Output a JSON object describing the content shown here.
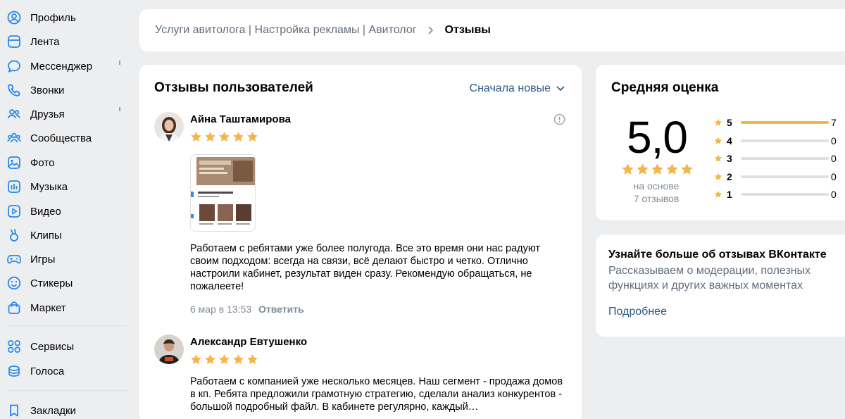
{
  "sidebar": {
    "items": [
      {
        "label": "Профиль",
        "icon": "profile-icon"
      },
      {
        "label": "Лента",
        "icon": "feed-icon"
      },
      {
        "label": "Мессенджер",
        "icon": "messenger-icon"
      },
      {
        "label": "Звонки",
        "icon": "phone-icon"
      },
      {
        "label": "Друзья",
        "icon": "friends-icon"
      },
      {
        "label": "Сообщества",
        "icon": "communities-icon"
      },
      {
        "label": "Фото",
        "icon": "photo-icon"
      },
      {
        "label": "Музыка",
        "icon": "music-icon"
      },
      {
        "label": "Видео",
        "icon": "video-icon"
      },
      {
        "label": "Клипы",
        "icon": "clips-icon"
      },
      {
        "label": "Игры",
        "icon": "games-icon"
      },
      {
        "label": "Стикеры",
        "icon": "stickers-icon"
      },
      {
        "label": "Маркет",
        "icon": "market-icon"
      }
    ],
    "items2": [
      {
        "label": "Сервисы",
        "icon": "services-icon"
      },
      {
        "label": "Голоса",
        "icon": "votes-icon"
      }
    ],
    "items3": [
      {
        "label": "Закладки",
        "icon": "bookmark-icon"
      }
    ]
  },
  "breadcrumb": {
    "parent": "Услуги авитолога | Настройка рекламы | Авитолог",
    "current": "Отзывы"
  },
  "reviews": {
    "title": "Отзывы пользователей",
    "sort_label": "Сначала новые",
    "items": [
      {
        "author": "Айна Таштамирова",
        "rating": 5,
        "text": "Работаем с ребятами уже более полугода. Все это время они нас радуют своим подходом: всегда на связи, всё делают быстро и четко. Отлично настроили кабинет, результат виден сразу. Рекомендую обращаться, не пожалеете!",
        "date": "6 мар в 13:53",
        "reply": "Ответить"
      },
      {
        "author": "Александр Евтушенко",
        "rating": 5,
        "text": "Работаем с компанией уже несколько месяцев. Наш сегмент - продажа домов в кп. Ребята предложили грамотную стратегию, сделали анализ конкурентов - большой подробный файл. В кабинете регулярно, каждый…"
      }
    ]
  },
  "rating": {
    "title": "Средняя оценка",
    "score": "5,0",
    "based_on": "на основе",
    "count_text": "7 отзывов",
    "distribution": [
      {
        "stars": "5",
        "count": "7",
        "fraction": 1
      },
      {
        "stars": "4",
        "count": "0",
        "fraction": 0
      },
      {
        "stars": "3",
        "count": "0",
        "fraction": 0
      },
      {
        "stars": "2",
        "count": "0",
        "fraction": 0
      },
      {
        "stars": "1",
        "count": "0",
        "fraction": 0
      }
    ]
  },
  "info": {
    "title": "Узнайте больше об отзывах ВКонтакте",
    "text": "Рассказываем о модерации, полезных функциях и других важных моментах",
    "link": "Подробнее"
  },
  "colors": {
    "accent": "#2a5885",
    "star": "#f5b44c",
    "icon": "#2688eb",
    "background": "#edeef0"
  }
}
